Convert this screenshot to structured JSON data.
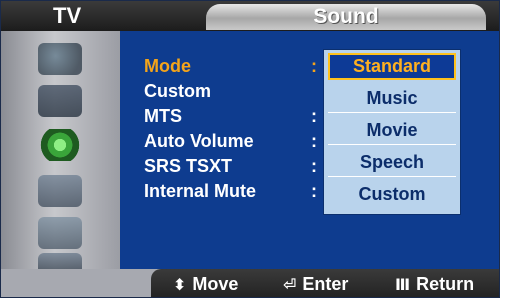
{
  "header": {
    "left_label": "TV",
    "title": "Sound"
  },
  "sidebar": {
    "icons": [
      "antenna-icon",
      "picture-icon",
      "sound-icon",
      "channel-icon",
      "setup-icon",
      "input-icon"
    ]
  },
  "menu": {
    "items": [
      {
        "label": "Mode",
        "separator": ":"
      },
      {
        "label": "Custom",
        "separator": ""
      },
      {
        "label": "MTS",
        "separator": ":"
      },
      {
        "label": "Auto Volume",
        "separator": ":"
      },
      {
        "label": "SRS TSXT",
        "separator": ":"
      },
      {
        "label": "Internal Mute",
        "separator": ":"
      }
    ],
    "selected_index": 0
  },
  "dropdown": {
    "options": [
      "Standard",
      "Music",
      "Movie",
      "Speech",
      "Custom"
    ],
    "selected": "Standard"
  },
  "footer": {
    "move": {
      "glyph": "⬍",
      "label": "Move"
    },
    "enter": {
      "glyph": "⏎",
      "label": "Enter"
    },
    "return": {
      "glyph": "Ⅲ",
      "label": "Return"
    }
  },
  "colors": {
    "panel": "#0e3c8f",
    "highlight": "#f4a41a",
    "dropdown_bg": "#b9d3ec"
  }
}
